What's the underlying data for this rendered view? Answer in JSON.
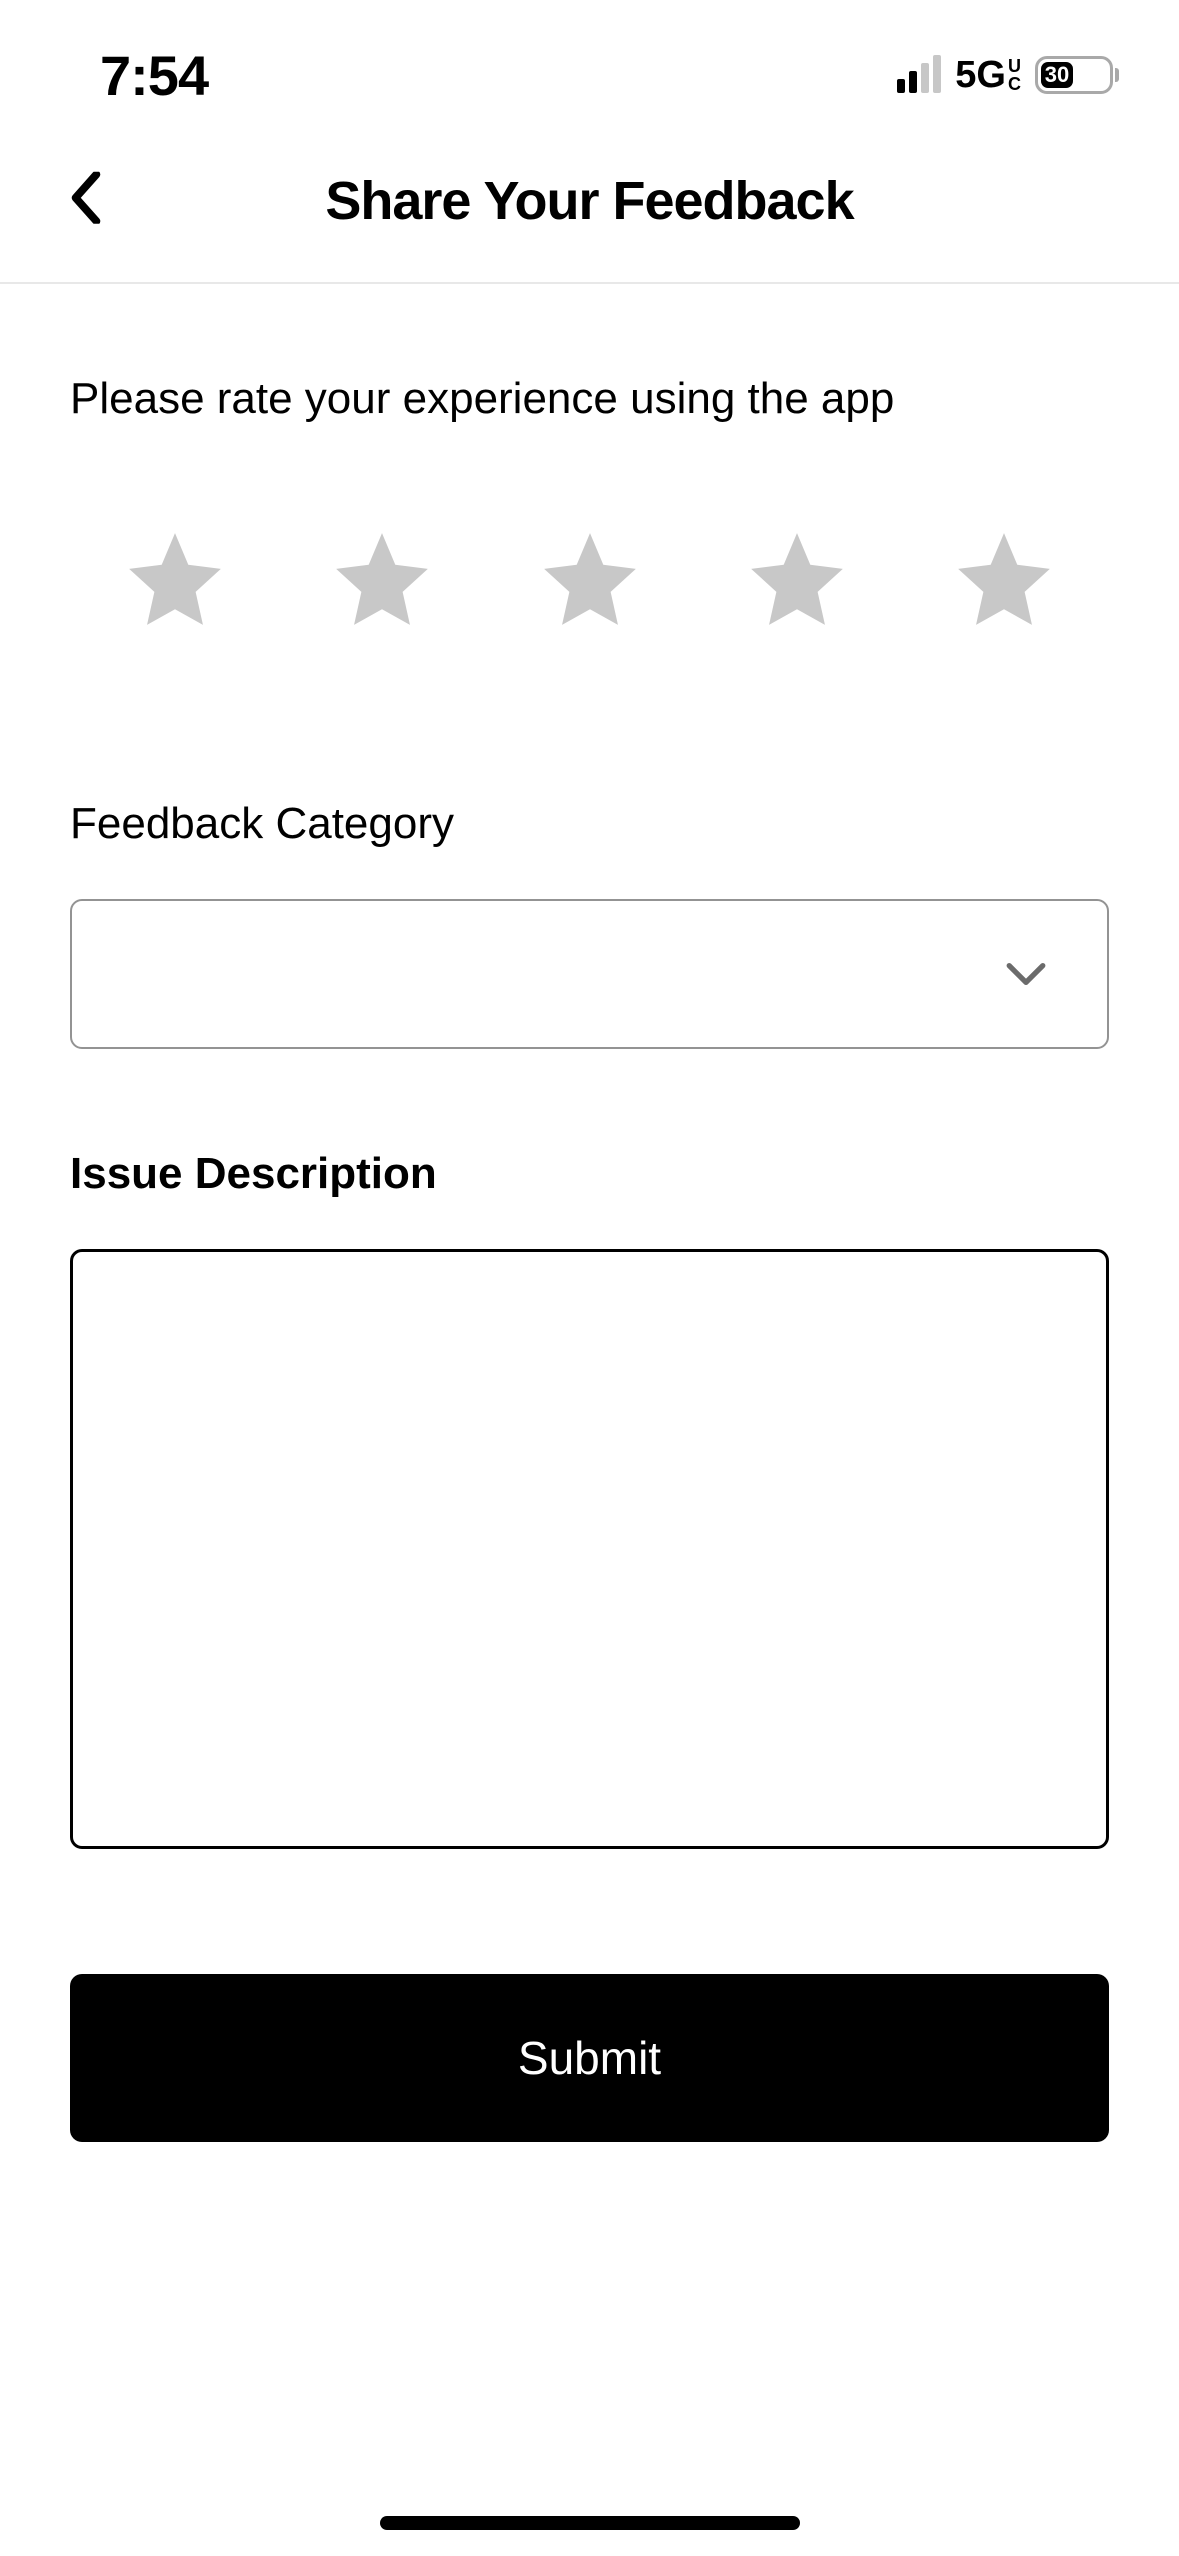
{
  "status": {
    "time": "7:54",
    "network": "5G",
    "network_sub1": "U",
    "network_sub2": "C",
    "battery_pct": "30"
  },
  "header": {
    "title": "Share Your Feedback"
  },
  "form": {
    "rating_prompt": "Please rate your experience using the app",
    "category_label": "Feedback Category",
    "category_value": "",
    "description_label": "Issue Description",
    "description_value": "",
    "submit_label": "Submit"
  }
}
